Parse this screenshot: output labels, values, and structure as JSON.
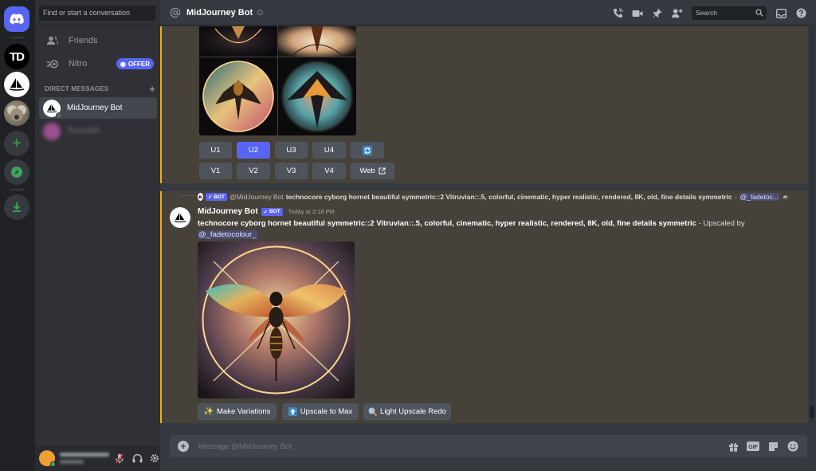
{
  "servers": {
    "home_label": "Direct Messages",
    "td_label": "TD"
  },
  "dm_sidebar": {
    "search_placeholder": "Find or start a conversation",
    "friends_label": "Friends",
    "nitro_label": "Nitro",
    "offer_badge": "OFFER",
    "section_header": "DIRECT MESSAGES",
    "conversations": [
      {
        "name": "MidJourney Bot",
        "active": true
      },
      {
        "name": "TexasWit",
        "blurred": true
      }
    ]
  },
  "header": {
    "channel_name": "MidJourney Bot",
    "search_placeholder": "Search"
  },
  "grid_message": {
    "upscale_buttons": [
      "U1",
      "U2",
      "U3",
      "U4"
    ],
    "variation_buttons": [
      "V1",
      "V2",
      "V3",
      "V4"
    ],
    "selected_button": "U2",
    "web_label": "Web"
  },
  "upscale_message": {
    "reply_author": "@MidJourney Bot",
    "reply_text": "technocore cyborg hornet beautiful symmetric::2 Vitruvian::.5, colorful, cinematic, hyper realistic, rendered, 8K, old, fine details symmetric",
    "reply_mention": "@_fadetoc...",
    "reply_dash": "-",
    "bot_tag": "BOT",
    "author": "MidJourney Bot",
    "timestamp": "Today at 2:18 PM",
    "prompt": "technocore cyborg hornet beautiful symmetric::2 Vitruvian::.5, colorful, cinematic, hyper realistic, rendered, 8K, old, fine details symmetric",
    "suffix": " - Upscaled by",
    "mention": "@_fadetocolour_",
    "actions": [
      {
        "label": "Make Variations",
        "icon": "sparkle-icon"
      },
      {
        "label": "Upscale to Max",
        "icon": "arrow-up-icon"
      },
      {
        "label": "Light Upscale Redo",
        "icon": "magnifier-icon"
      }
    ]
  },
  "composer": {
    "placeholder": "Message @MidJourney Bot"
  },
  "colors": {
    "blurple": "#5865f2",
    "highlight": "#46423a",
    "mention_border": "#faa81a",
    "green": "#3ba55d"
  }
}
